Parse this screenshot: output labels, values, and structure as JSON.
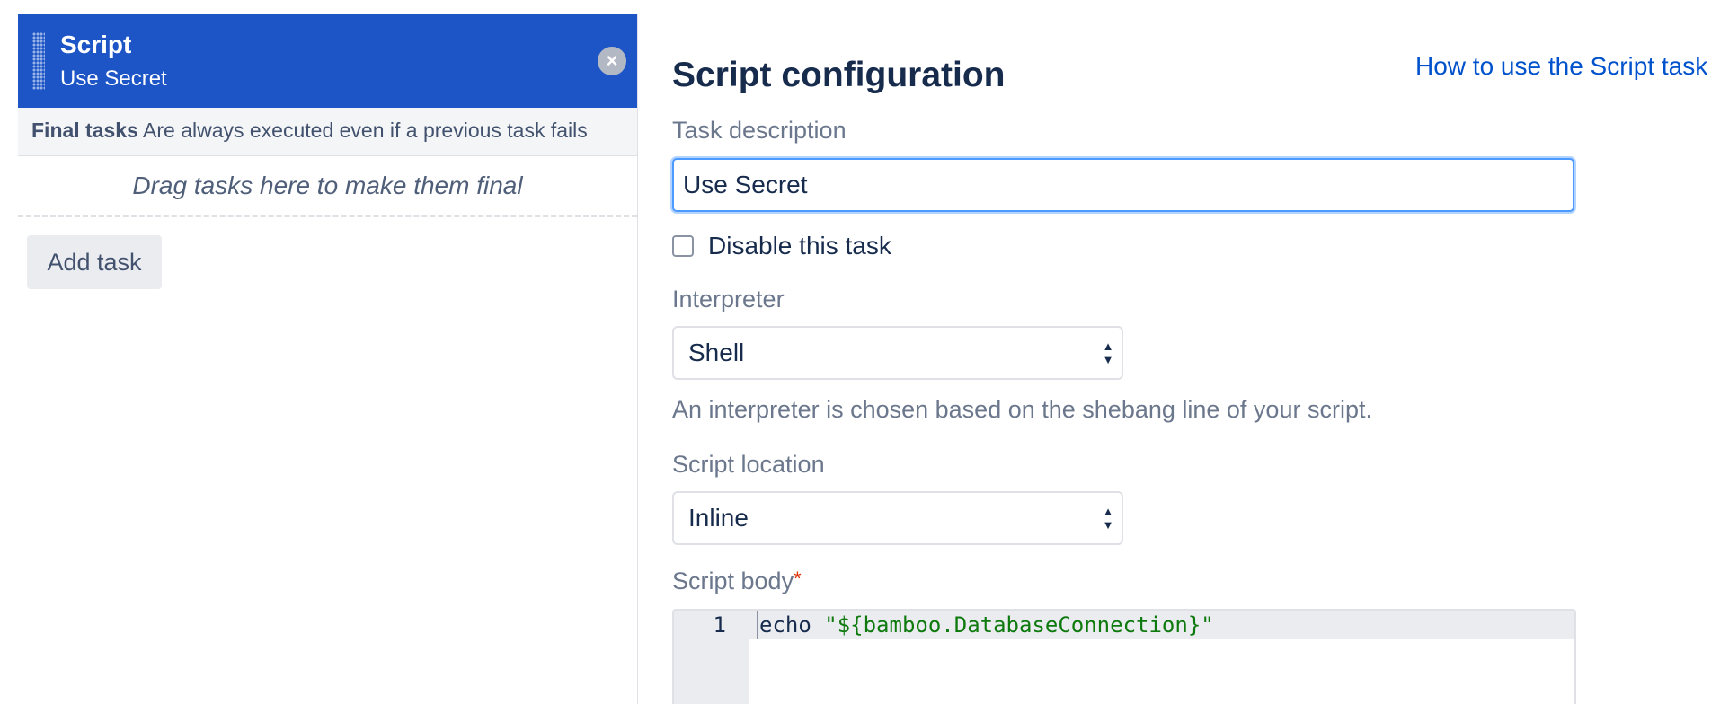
{
  "left": {
    "task": {
      "title": "Script",
      "subtitle": "Use Secret",
      "remove_icon": "close-icon"
    },
    "final_tasks": {
      "label": "Final tasks",
      "description": "Are always executed even if a previous task fails"
    },
    "drop_hint": "Drag tasks here to make them final",
    "add_task_label": "Add task"
  },
  "config": {
    "title": "Script configuration",
    "help_link": "How to use the Script task",
    "task_description": {
      "label": "Task description",
      "value": "Use Secret"
    },
    "disable_task": {
      "label": "Disable this task",
      "checked": false
    },
    "interpreter": {
      "label": "Interpreter",
      "value": "Shell",
      "hint": "An interpreter is chosen based on the shebang line of your script."
    },
    "script_location": {
      "label": "Script location",
      "value": "Inline"
    },
    "script_body": {
      "label": "Script body",
      "required_marker": "*",
      "lines": [
        {
          "number": "1",
          "keyword": "echo",
          "string": "\"${bamboo.DatabaseConnection}\""
        }
      ]
    }
  },
  "colors": {
    "accent": "#1d55c7",
    "link": "#0052cc",
    "required": "#de350b",
    "code_string": "#0e7a0e"
  }
}
